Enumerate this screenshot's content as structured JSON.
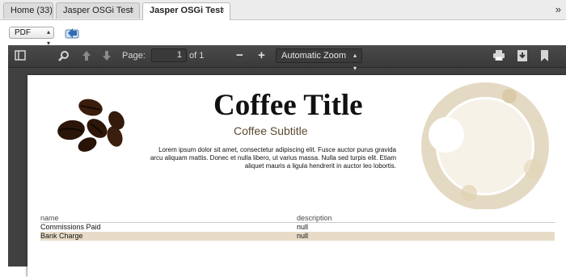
{
  "tabs": [
    {
      "label": "Home (33)",
      "closable": false,
      "active": false
    },
    {
      "label": "Jasper OSGi Test",
      "closable": true,
      "active": false
    },
    {
      "label": "Jasper OSGi Test",
      "closable": true,
      "active": true
    }
  ],
  "tab_close_symbol": "×",
  "tab_overflow_symbol": "»",
  "toolbar": {
    "format_selected": "PDF",
    "export_icon": "export-icon"
  },
  "viewer": {
    "page_label": "Page:",
    "page_number": "1",
    "page_of": "of 1",
    "zoom_selected": "Automatic Zoom",
    "icons": [
      "sidebar-toggle-icon",
      "search-icon",
      "previous-page-icon",
      "next-page-icon",
      "zoom-out-icon",
      "zoom-in-icon",
      "print-icon",
      "download-icon",
      "bookmark-icon"
    ]
  },
  "document": {
    "title": "Coffee Title",
    "subtitle": "Coffee Subtitle",
    "body": "Lorem ipsum dolor sit amet, consectetur adipiscing elit. Fusce auctor purus gravida arcu aliquam mattis. Donec et nulla libero, ut varius massa. Nulla sed turpis elit. Etiam aliquet mauris a ligula hendrerit in auctor leo lobortis.",
    "table": {
      "columns": [
        "name",
        "description"
      ],
      "rows": [
        {
          "name": "Commissions Paid",
          "description": "null"
        },
        {
          "name": "Bank Charge",
          "description": "null"
        }
      ]
    }
  },
  "colors": {
    "viewer_bg": "#404040",
    "row_highlight": "#e8dcc8",
    "subtitle": "#5a4a30"
  }
}
